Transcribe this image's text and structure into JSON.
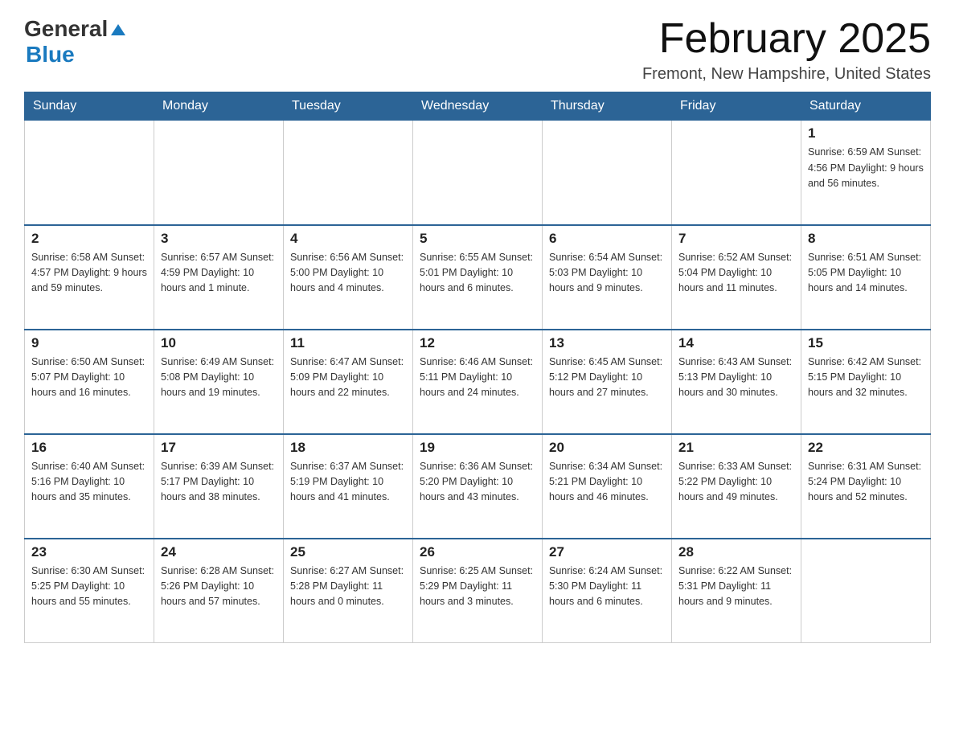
{
  "header": {
    "logo_general": "General",
    "logo_blue": "Blue",
    "month_title": "February 2025",
    "location": "Fremont, New Hampshire, United States"
  },
  "weekdays": [
    "Sunday",
    "Monday",
    "Tuesday",
    "Wednesday",
    "Thursday",
    "Friday",
    "Saturday"
  ],
  "weeks": [
    [
      {
        "day": "",
        "info": ""
      },
      {
        "day": "",
        "info": ""
      },
      {
        "day": "",
        "info": ""
      },
      {
        "day": "",
        "info": ""
      },
      {
        "day": "",
        "info": ""
      },
      {
        "day": "",
        "info": ""
      },
      {
        "day": "1",
        "info": "Sunrise: 6:59 AM\nSunset: 4:56 PM\nDaylight: 9 hours\nand 56 minutes."
      }
    ],
    [
      {
        "day": "2",
        "info": "Sunrise: 6:58 AM\nSunset: 4:57 PM\nDaylight: 9 hours\nand 59 minutes."
      },
      {
        "day": "3",
        "info": "Sunrise: 6:57 AM\nSunset: 4:59 PM\nDaylight: 10 hours\nand 1 minute."
      },
      {
        "day": "4",
        "info": "Sunrise: 6:56 AM\nSunset: 5:00 PM\nDaylight: 10 hours\nand 4 minutes."
      },
      {
        "day": "5",
        "info": "Sunrise: 6:55 AM\nSunset: 5:01 PM\nDaylight: 10 hours\nand 6 minutes."
      },
      {
        "day": "6",
        "info": "Sunrise: 6:54 AM\nSunset: 5:03 PM\nDaylight: 10 hours\nand 9 minutes."
      },
      {
        "day": "7",
        "info": "Sunrise: 6:52 AM\nSunset: 5:04 PM\nDaylight: 10 hours\nand 11 minutes."
      },
      {
        "day": "8",
        "info": "Sunrise: 6:51 AM\nSunset: 5:05 PM\nDaylight: 10 hours\nand 14 minutes."
      }
    ],
    [
      {
        "day": "9",
        "info": "Sunrise: 6:50 AM\nSunset: 5:07 PM\nDaylight: 10 hours\nand 16 minutes."
      },
      {
        "day": "10",
        "info": "Sunrise: 6:49 AM\nSunset: 5:08 PM\nDaylight: 10 hours\nand 19 minutes."
      },
      {
        "day": "11",
        "info": "Sunrise: 6:47 AM\nSunset: 5:09 PM\nDaylight: 10 hours\nand 22 minutes."
      },
      {
        "day": "12",
        "info": "Sunrise: 6:46 AM\nSunset: 5:11 PM\nDaylight: 10 hours\nand 24 minutes."
      },
      {
        "day": "13",
        "info": "Sunrise: 6:45 AM\nSunset: 5:12 PM\nDaylight: 10 hours\nand 27 minutes."
      },
      {
        "day": "14",
        "info": "Sunrise: 6:43 AM\nSunset: 5:13 PM\nDaylight: 10 hours\nand 30 minutes."
      },
      {
        "day": "15",
        "info": "Sunrise: 6:42 AM\nSunset: 5:15 PM\nDaylight: 10 hours\nand 32 minutes."
      }
    ],
    [
      {
        "day": "16",
        "info": "Sunrise: 6:40 AM\nSunset: 5:16 PM\nDaylight: 10 hours\nand 35 minutes."
      },
      {
        "day": "17",
        "info": "Sunrise: 6:39 AM\nSunset: 5:17 PM\nDaylight: 10 hours\nand 38 minutes."
      },
      {
        "day": "18",
        "info": "Sunrise: 6:37 AM\nSunset: 5:19 PM\nDaylight: 10 hours\nand 41 minutes."
      },
      {
        "day": "19",
        "info": "Sunrise: 6:36 AM\nSunset: 5:20 PM\nDaylight: 10 hours\nand 43 minutes."
      },
      {
        "day": "20",
        "info": "Sunrise: 6:34 AM\nSunset: 5:21 PM\nDaylight: 10 hours\nand 46 minutes."
      },
      {
        "day": "21",
        "info": "Sunrise: 6:33 AM\nSunset: 5:22 PM\nDaylight: 10 hours\nand 49 minutes."
      },
      {
        "day": "22",
        "info": "Sunrise: 6:31 AM\nSunset: 5:24 PM\nDaylight: 10 hours\nand 52 minutes."
      }
    ],
    [
      {
        "day": "23",
        "info": "Sunrise: 6:30 AM\nSunset: 5:25 PM\nDaylight: 10 hours\nand 55 minutes."
      },
      {
        "day": "24",
        "info": "Sunrise: 6:28 AM\nSunset: 5:26 PM\nDaylight: 10 hours\nand 57 minutes."
      },
      {
        "day": "25",
        "info": "Sunrise: 6:27 AM\nSunset: 5:28 PM\nDaylight: 11 hours\nand 0 minutes."
      },
      {
        "day": "26",
        "info": "Sunrise: 6:25 AM\nSunset: 5:29 PM\nDaylight: 11 hours\nand 3 minutes."
      },
      {
        "day": "27",
        "info": "Sunrise: 6:24 AM\nSunset: 5:30 PM\nDaylight: 11 hours\nand 6 minutes."
      },
      {
        "day": "28",
        "info": "Sunrise: 6:22 AM\nSunset: 5:31 PM\nDaylight: 11 hours\nand 9 minutes."
      },
      {
        "day": "",
        "info": ""
      }
    ]
  ]
}
